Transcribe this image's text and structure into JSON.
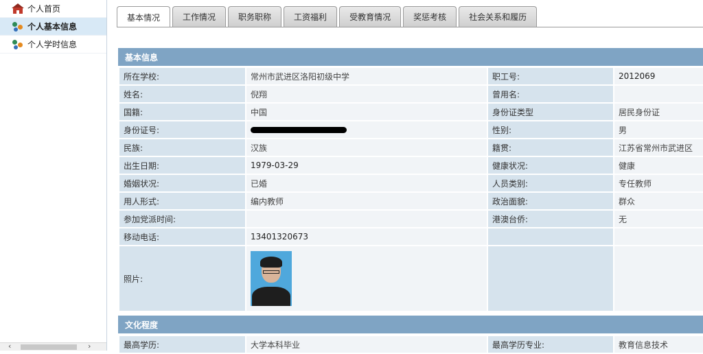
{
  "sidebar": {
    "items": [
      {
        "label": "个人首页",
        "icon": "home-icon"
      },
      {
        "label": "个人基本信息",
        "icon": "users-icon",
        "active": true
      },
      {
        "label": "个人学时信息",
        "icon": "users-icon"
      }
    ]
  },
  "tabs": [
    "基本情况",
    "工作情况",
    "职务职称",
    "工资福利",
    "受教育情况",
    "奖惩考核",
    "社会关系和履历"
  ],
  "sections": {
    "basic": "基本信息",
    "education": "文化程度"
  },
  "basic_rows": [
    [
      "所在学校:",
      "常州市武进区洛阳初级中学",
      "职工号:",
      "2012069"
    ],
    [
      "姓名:",
      "倪翔",
      "曾用名:",
      ""
    ],
    [
      "国籍:",
      "中国",
      "身份证类型",
      "居民身份证"
    ],
    [
      "身份证号:",
      "",
      "性别:",
      "男"
    ],
    [
      "民族:",
      "汉族",
      "籍贯:",
      "江苏省常州市武进区"
    ],
    [
      "出生日期:",
      "1979-03-29",
      "健康状况:",
      "健康"
    ],
    [
      "婚姻状况:",
      "已婚",
      "人员类别:",
      "专任教师"
    ],
    [
      "用人形式:",
      "编内教师",
      "政治面貌:",
      "群众"
    ],
    [
      "参加党派时间:",
      "",
      "港澳台侨:",
      "无"
    ],
    [
      "移动电话:",
      "13401320673",
      "",
      ""
    ]
  ],
  "photo_label": "照片:",
  "education_row": [
    "最高学历:",
    "大学本科毕业",
    "最高学历专业:",
    "教育信息技术"
  ]
}
